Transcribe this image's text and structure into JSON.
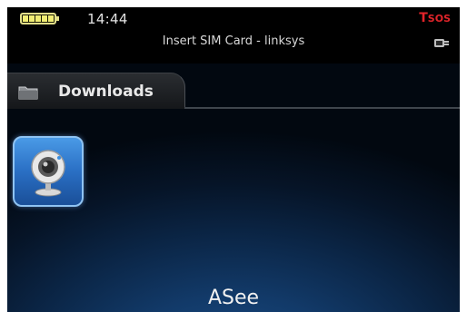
{
  "status_bar": {
    "time": "14:44",
    "network_status": "Insert SIM Card - linksys",
    "signal_indicator": "T",
    "signal_text": "SOS",
    "battery_icon": "battery-icon",
    "charging_icon": "plug-icon"
  },
  "folder": {
    "label": "Downloads",
    "icon": "folder-icon"
  },
  "app": {
    "icon": "webcam-icon",
    "label": "ASee"
  },
  "colors": {
    "background_top": "#000000",
    "background_glow": "#1b4d86",
    "selection_border": "#8fc3f2",
    "signal_red": "#e2242a",
    "battery_yellow": "#f1ed73"
  }
}
